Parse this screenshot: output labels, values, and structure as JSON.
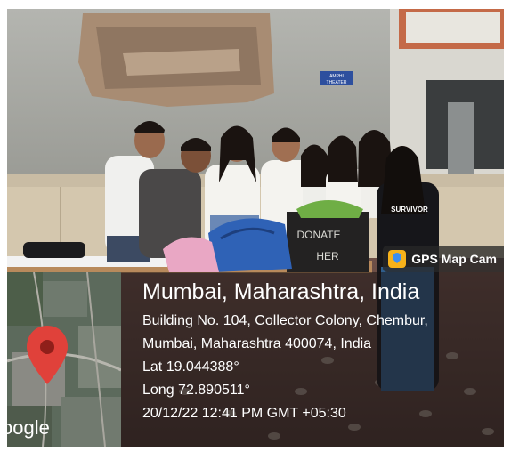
{
  "gps_badge": {
    "label": "GPS Map Cam",
    "icon": "gps-map-cam-app-icon"
  },
  "location": {
    "city": "Mumbai, Maharashtra, India",
    "address_line_1": "Building No. 104, Collector Colony, Chembur,",
    "address_line_2": "Mumbai, Maharashtra 400074, India",
    "latitude": "Lat 19.044388°",
    "longitude": "Long 72.890511°",
    "datetime": "20/12/22 12:41 PM GMT +05:30"
  },
  "map": {
    "attribution": "oogle",
    "pin_icon": "map-pin-icon"
  },
  "scene": {
    "box_text_1": "DONATE",
    "box_text_2": "HER",
    "door_sign_1": "AMPHI",
    "door_sign_2": "THEATER",
    "shirt_text": "SURVIVOR"
  },
  "colors": {
    "pin": "#e0413a",
    "badge_icon": "#f6b21b",
    "overlay": "#191414"
  }
}
